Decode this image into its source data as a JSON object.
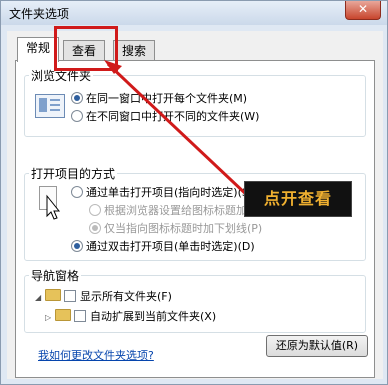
{
  "window": {
    "title": "文件夹选项",
    "close_glyph": "✕"
  },
  "tabs": [
    {
      "label": "常规",
      "active": true
    },
    {
      "label": "查看",
      "active": false
    },
    {
      "label": "搜索",
      "active": false
    }
  ],
  "browse": {
    "label": "浏览文件夹",
    "options": [
      {
        "label": "在同一窗口中打开每个文件夹(M)",
        "selected": true
      },
      {
        "label": "在不同窗口中打开不同的文件夹(W)",
        "selected": false
      }
    ]
  },
  "open": {
    "label": "打开项目的方式",
    "single_click": "通过单击打开项目(指向时选定)(S)",
    "sub_options": [
      {
        "label": "根据浏览器设置给图标标题加下划线(B)",
        "selected": false
      },
      {
        "label": "仅当指向图标标题时加下划线(P)",
        "selected": true
      }
    ],
    "double_click": "通过双击打开项目(单击时选定)(D)"
  },
  "nav": {
    "label": "导航窗格",
    "show_all": "显示所有文件夹(F)",
    "auto_expand": "自动扩展到当前文件夹(X)"
  },
  "restore_button": "还原为默认值(R)",
  "help_link": "我如何更改文件夹选项?",
  "annotation": {
    "callout_text": "点开查看",
    "color": "#d01a1a"
  },
  "icons": {
    "close": "close-icon",
    "browse_preview": "window-preview-icon",
    "click_cursor": "pointer-cursor-icon",
    "folder": "folder-icon"
  }
}
